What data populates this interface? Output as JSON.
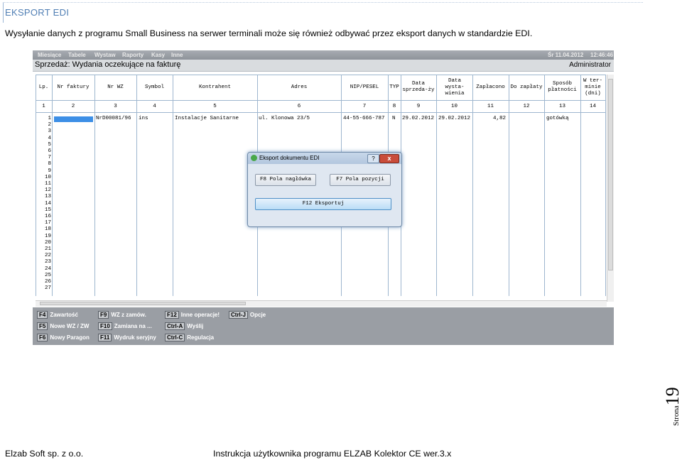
{
  "section_title": "EKSPORT EDI",
  "intro_text": "Wysyłanie danych z programu Small Business na serwer terminali może się również odbywać przez eksport danych w standardzie EDI.",
  "app": {
    "menu": [
      "Miesiące",
      "Tabele",
      "Wystaw",
      "Raporty",
      "Kasy",
      "Inne"
    ],
    "menu_date": "Śr 11.04.2012",
    "menu_time": "12:46:46",
    "window_title": "Sprzedaż: Wydania oczekujące na fakturę",
    "user": "Administrator",
    "columns": [
      "Lp.",
      "Nr faktury",
      "Nr WZ",
      "Symbol",
      "Kontrahent",
      "Adres",
      "NIP/PESEL",
      "TYP",
      "Data sprzeda-ży",
      "Data wysta-wienia",
      "Zapłacono",
      "Do zapłaty",
      "Sposób płatności",
      "W ter-minie (dni)"
    ],
    "column_numbers": [
      "1",
      "2",
      "3",
      "4",
      "5",
      "6",
      "7",
      "8",
      "9",
      "10",
      "11",
      "12",
      "13",
      "14"
    ],
    "row_numbers": [
      "1",
      "2",
      "3",
      "4",
      "5",
      "6",
      "7",
      "8",
      "9",
      "10",
      "11",
      "12",
      "13",
      "14",
      "15",
      "16",
      "17",
      "18",
      "19",
      "20",
      "21",
      "22",
      "23",
      "24",
      "25",
      "26",
      "27"
    ],
    "row1": {
      "nr_wz": "NrD00081/96",
      "symbol": "ins",
      "kontrahent": "Instalacje Sanitarne",
      "adres": "ul. Klonowa  23/5",
      "nip": "44-55-666-787",
      "typ": "N",
      "data_sprzedazy": "29.02.2012",
      "data_wystawienia": "29.02.2012",
      "zaplacono": "4,82",
      "sposob": "gotówką"
    },
    "function_keys": [
      {
        "key": "F4",
        "label": "Zawartość"
      },
      {
        "key": "F9",
        "label": "WZ z zamów."
      },
      {
        "key": "F12",
        "label": "Inne operacje!"
      },
      {
        "key": "Ctrl-J",
        "label": "Opcje"
      },
      {
        "key": "F5",
        "label": "Nowe WZ / ZW"
      },
      {
        "key": "F10",
        "label": "Zamiana na ..."
      },
      {
        "key": "Ctrl-A",
        "label": "Wyślij"
      },
      {
        "key": "F6",
        "label": "Nowy Paragon"
      },
      {
        "key": "F11",
        "label": "Wydruk seryjny"
      },
      {
        "key": "Ctrl-C",
        "label": "Regulacja"
      }
    ],
    "dialog": {
      "title": "Eksport dokumentu EDI",
      "help": "?",
      "close": "x",
      "btn_header": "F8 Pola nagłówka",
      "btn_items": "F7 Pola pozycji",
      "btn_export": "F12 Eksportuj"
    }
  },
  "page_label": "Strona",
  "page_number": "19",
  "footer_left": "Elzab Soft sp. z o.o.",
  "footer_right": "Instrukcja użytkownika programu ELZAB Kolektor CE wer.3.x"
}
